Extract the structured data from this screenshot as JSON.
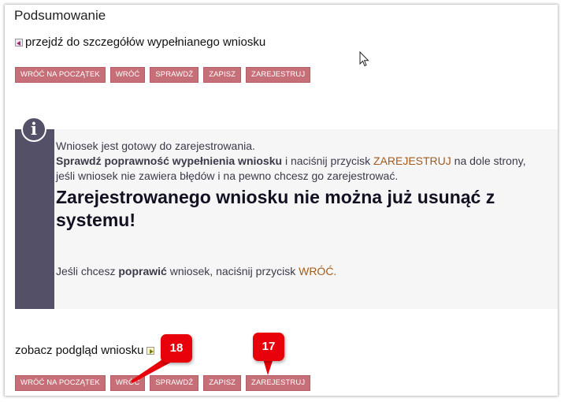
{
  "page": {
    "title": "Podsumowanie",
    "details_link": "przejdź do szczegółów wypełnianego wniosku",
    "preview_link": "zobacz podgląd wniosku"
  },
  "buttons": {
    "start": "WRÓĆ NA POCZĄTEK",
    "back": "WRÓĆ",
    "check": "SPRAWDŹ",
    "save": "ZAPISZ",
    "register": "ZAREJESTRUJ"
  },
  "info": {
    "line1": "Wniosek jest gotowy do zarejestrowania.",
    "line2_bold": "Sprawdź poprawność wypełnienia wniosku",
    "line2_mid": " i naciśnij przycisk ",
    "line2_accent": "ZAREJESTRUJ",
    "line2_end": " na dole strony, jeśli wniosek nie zawiera błędów i na pewno chcesz go zarejestrować.",
    "warning": "Zarejestrowanego wniosku nie można już usunąć z systemu!",
    "line3_start": "Jeśli chcesz ",
    "line3_bold": "poprawić",
    "line3_mid": " wniosek, naciśnij przycisk ",
    "line3_accent": "WRÓĆ."
  },
  "annotations": {
    "callout_back": "18",
    "callout_register": "17"
  },
  "colors": {
    "button_bg": "#c76f78",
    "info_bar": "#545067",
    "accent_text": "#a35a1a",
    "callout": "#e8000a"
  },
  "icons": [
    "arrow-left-box-icon",
    "info-icon",
    "arrow-right-box-icon",
    "mouse-cursor-icon"
  ]
}
